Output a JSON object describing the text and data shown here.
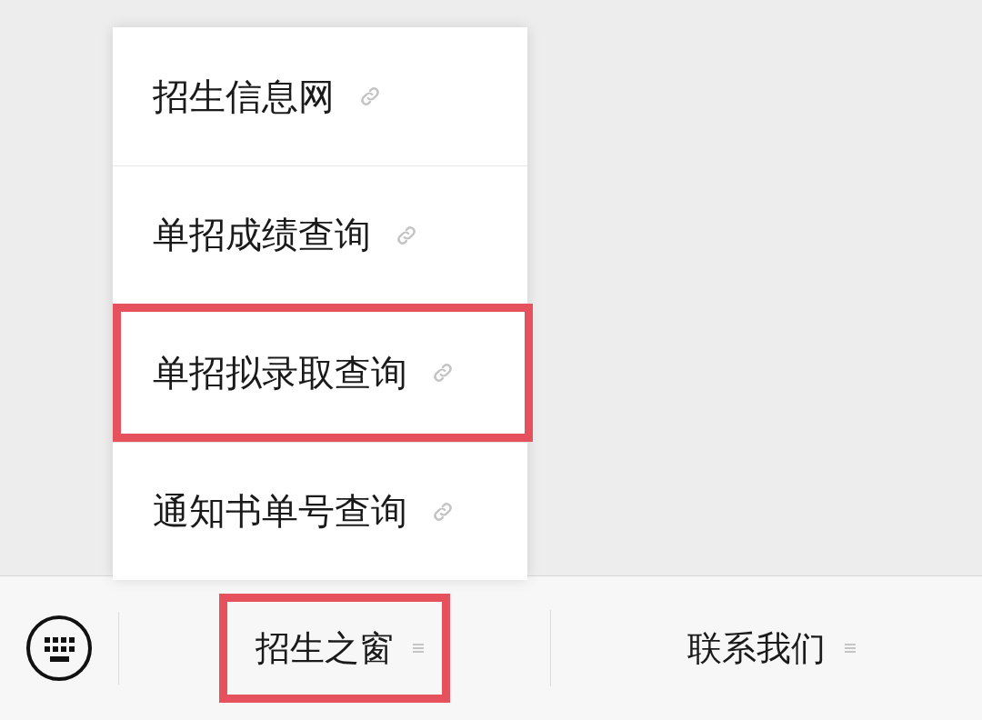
{
  "popup_menu": {
    "items": [
      {
        "label": "招生信息网",
        "highlighted": false
      },
      {
        "label": "单招成绩查询",
        "highlighted": false
      },
      {
        "label": "单招拟录取查询",
        "highlighted": true
      },
      {
        "label": "通知书单号查询",
        "highlighted": false
      }
    ]
  },
  "bottom_menu": {
    "buttons": [
      {
        "label": "招生之窗",
        "highlighted": true
      },
      {
        "label": "联系我们",
        "highlighted": false
      }
    ]
  }
}
